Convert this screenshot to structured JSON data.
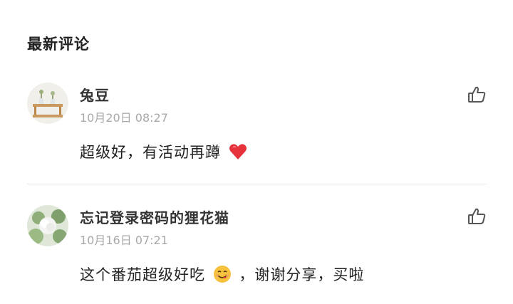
{
  "section": {
    "title": "最新评论"
  },
  "comments": [
    {
      "username": "兔豆",
      "time": "10月20日 08:27",
      "text": "超级好，有活动再蹲",
      "emoji": "heart-icon"
    },
    {
      "username": "忘记登录密码的狸花猫",
      "time": "10月16日 07:21",
      "text_before": "这个番茄超级好吃",
      "emoji": "yum-face-icon",
      "text_after": "，谢谢分享，买啦"
    }
  ],
  "colors": {
    "title": "#222222",
    "username": "#333333",
    "timestamp": "#a8a8a8",
    "divider": "#e8e8e8",
    "heart": "#e5323b",
    "emoji_face": "#f6c23e"
  }
}
